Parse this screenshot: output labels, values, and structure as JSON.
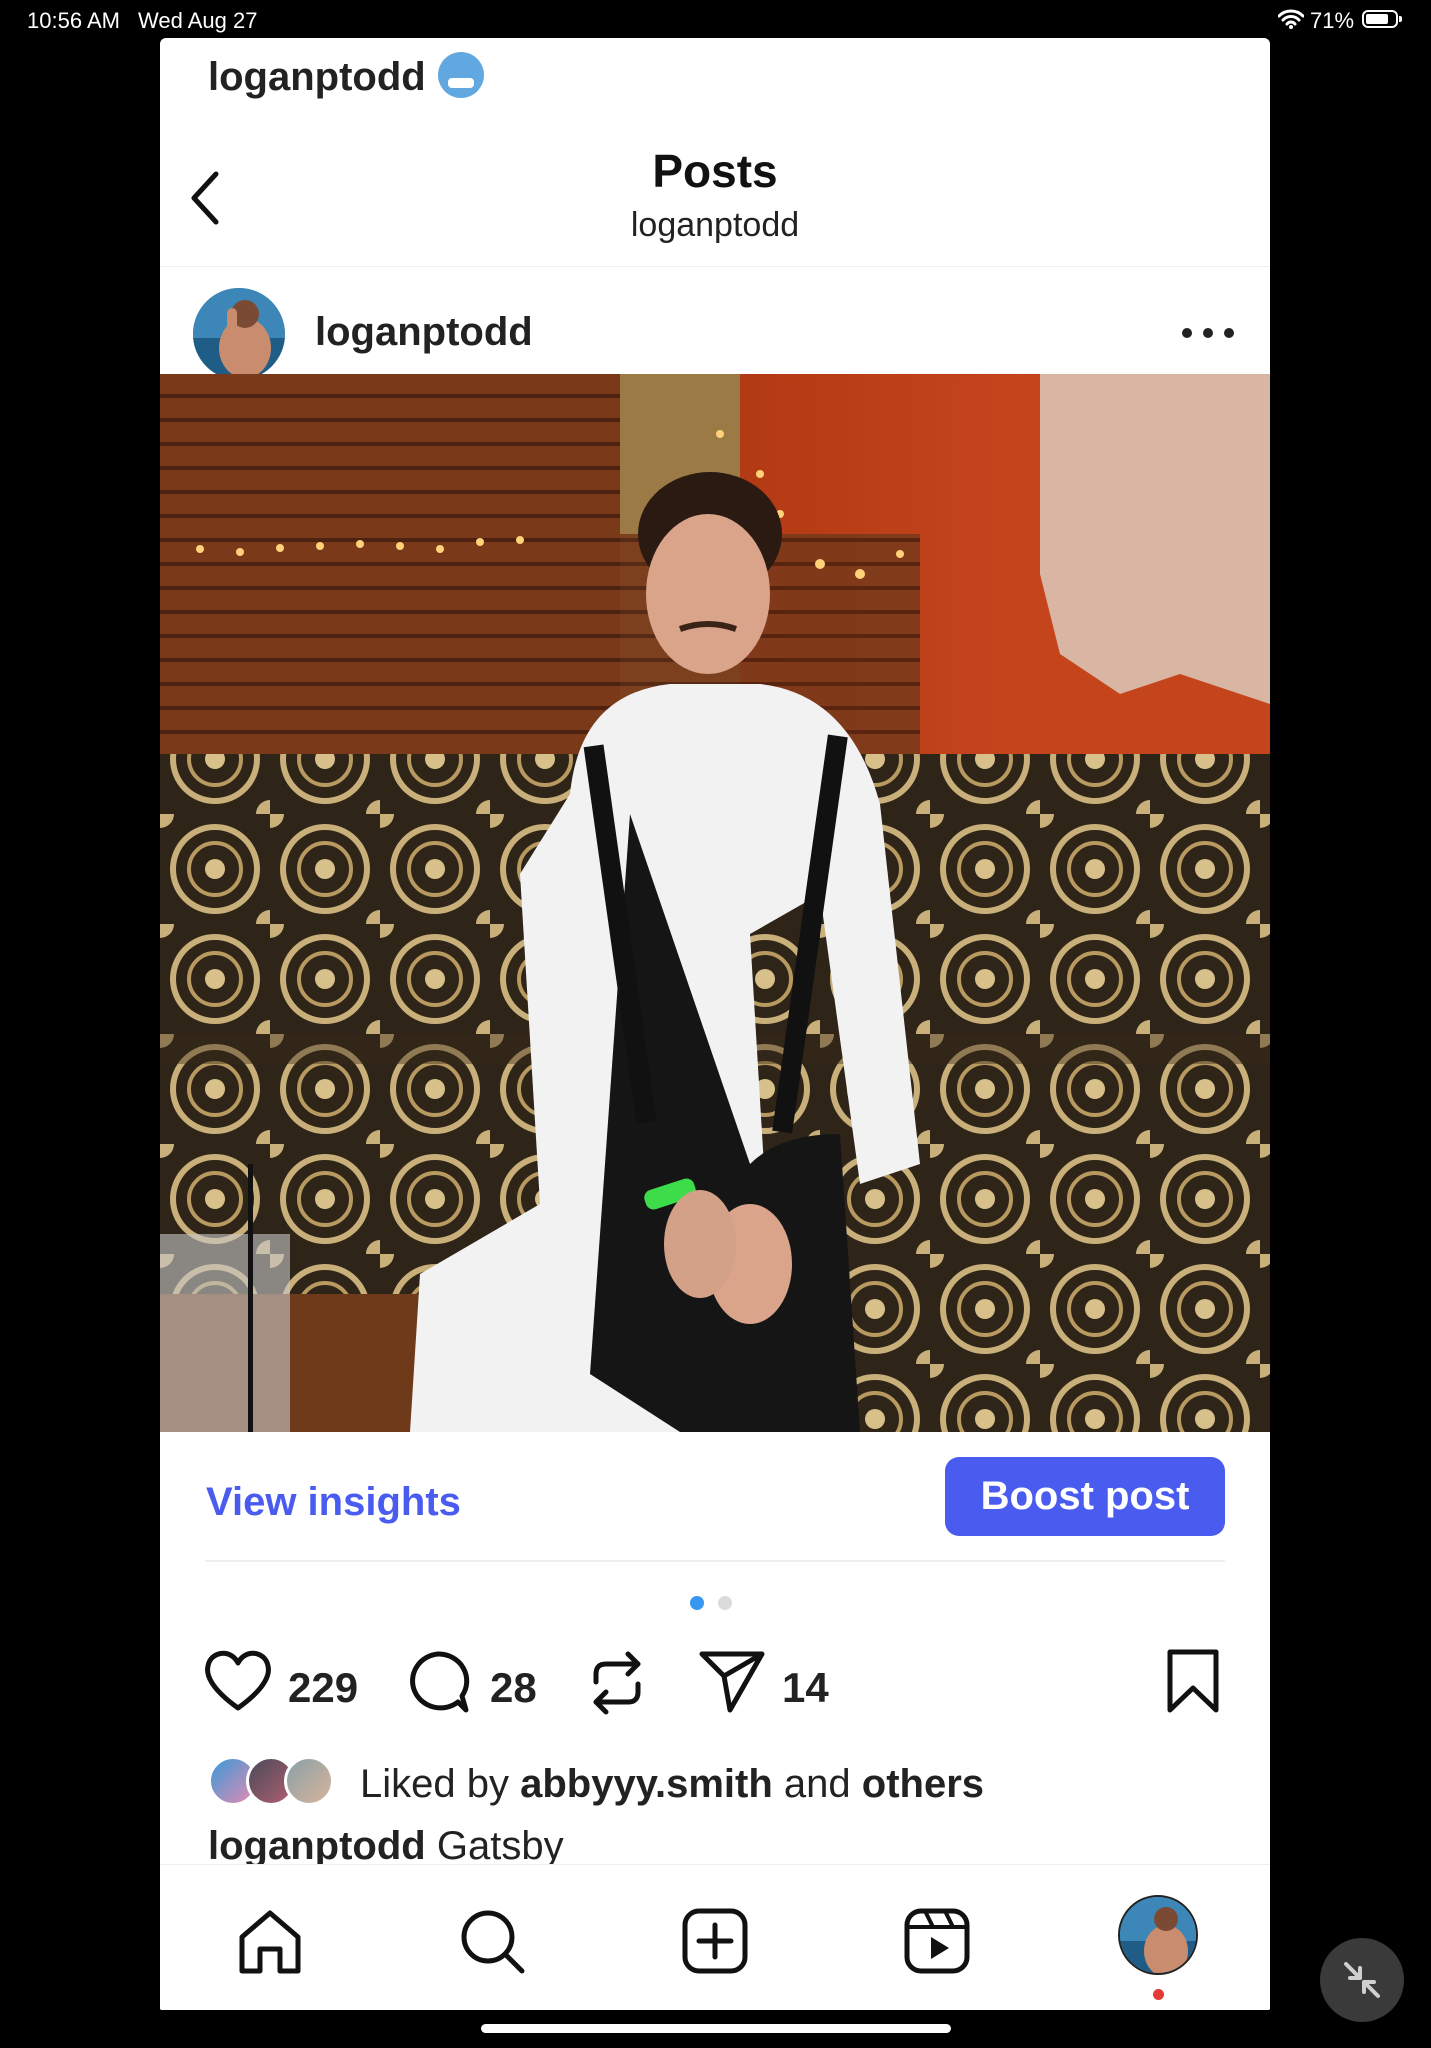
{
  "status_bar": {
    "time": "10:56 AM",
    "date": "Wed Aug 27",
    "battery": "71%"
  },
  "peek": {
    "username": "loganptodd"
  },
  "header": {
    "title": "Posts",
    "subtitle": "loganptodd"
  },
  "post": {
    "username": "loganptodd",
    "view_insights": "View insights",
    "boost": "Boost post",
    "likes": "229",
    "comments": "28",
    "shares": "14",
    "liked_by_prefix": "Liked by",
    "liked_by_user": "abbyyy.smith",
    "liked_by_and": "and",
    "liked_by_others": "others",
    "caption_user": "loganptodd",
    "caption_text": "Gatsby",
    "carousel_active": 1,
    "carousel_count": 2
  },
  "colors": {
    "accent": "#4a5bf0",
    "dot_active": "#3897f0",
    "dot_inactive": "#dbdbdb",
    "notification": "#e53935"
  },
  "icons": {
    "back": "chevron-left-icon",
    "more": "more-horizontal-icon",
    "like": "heart-icon",
    "comment": "comment-icon",
    "repost": "repost-icon",
    "share": "send-icon",
    "save": "bookmark-icon",
    "nav_home": "home-icon",
    "nav_search": "search-icon",
    "nav_create": "create-icon",
    "nav_reels": "reels-icon"
  }
}
